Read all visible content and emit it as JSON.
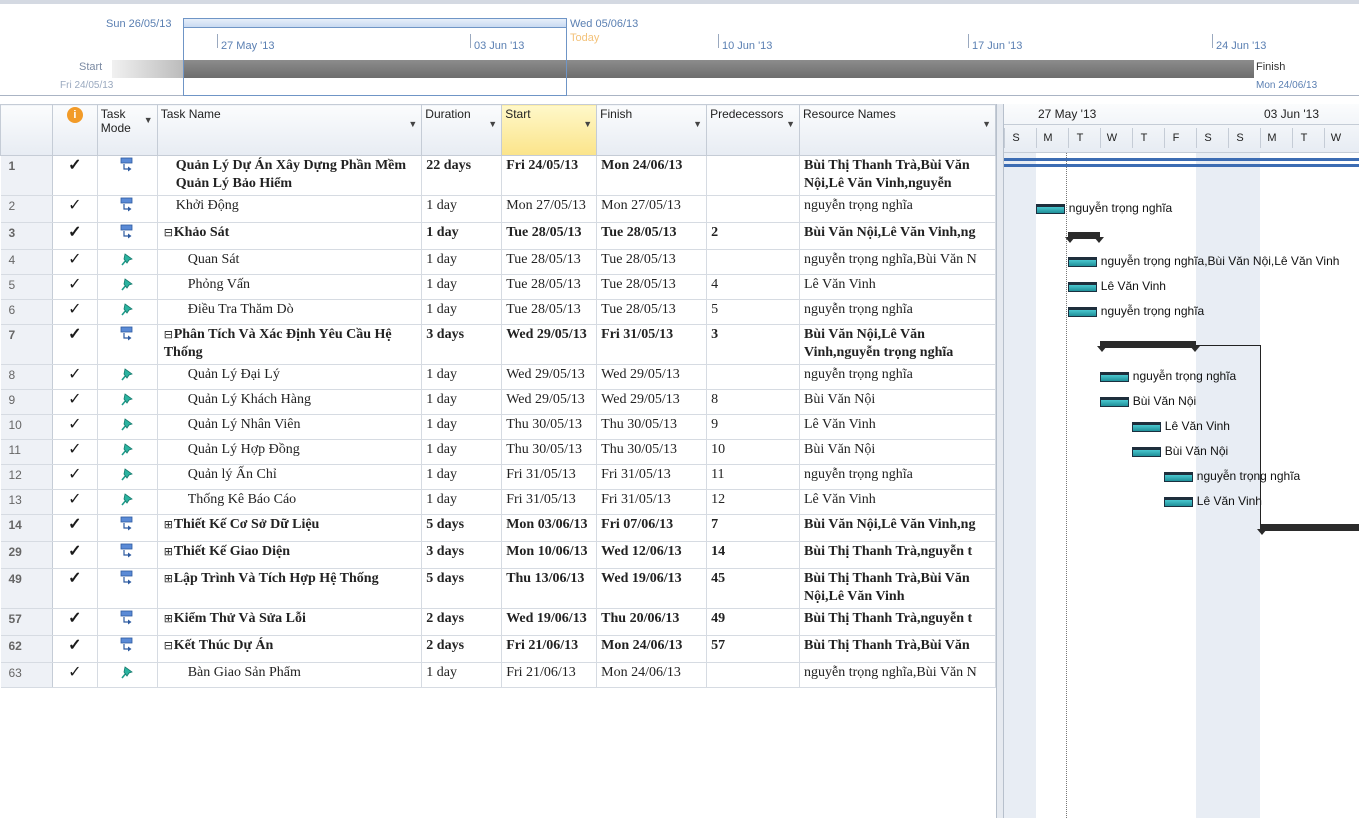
{
  "timeline": {
    "left_date": "Sun 26/05/13",
    "right_date": "Wed 05/06/13",
    "today_label": "Today",
    "start_label": "Start",
    "start_date": "Fri 24/05/13",
    "finish_label": "Finish",
    "finish_date": "Mon 24/06/13",
    "ticks": [
      "27 May '13",
      "03 Jun '13",
      "10 Jun '13",
      "17 Jun '13",
      "24 Jun '13"
    ]
  },
  "columns": {
    "info": "i",
    "task_mode": "Task Mode",
    "task_name": "Task Name",
    "duration": "Duration",
    "start": "Start",
    "finish": "Finish",
    "predecessors": "Predecessors",
    "resource_names": "Resource Names"
  },
  "tasks": [
    {
      "id": "1",
      "mode": "auto",
      "name": "Quản Lý Dự Án Xây Dựng Phần Mềm Quản Lý Bảo Hiểm",
      "duration": "22 days",
      "start": "Fri 24/05/13",
      "finish": "Mon 24/06/13",
      "pred": "",
      "res": "Bùi Thị Thanh Trà,Bùi Văn Nội,Lê Văn Vinh,nguyễn",
      "summary": true,
      "indent": "ind2",
      "wrap": true,
      "toggle": ""
    },
    {
      "id": "2",
      "mode": "auto",
      "name": "Khởi Động",
      "duration": "1 day",
      "start": "Mon 27/05/13",
      "finish": "Mon 27/05/13",
      "pred": "",
      "res": "nguyễn trọng nghĩa",
      "summary": false,
      "indent": "ind2",
      "wrap": false,
      "toggle": ""
    },
    {
      "id": "3",
      "mode": "auto",
      "name": "Khảo Sát",
      "duration": "1 day",
      "start": "Tue 28/05/13",
      "finish": "Tue 28/05/13",
      "pred": "2",
      "res": "Bùi Văn Nội,Lê Văn Vinh,ng",
      "summary": true,
      "indent": "ind1",
      "wrap": false,
      "toggle": "−"
    },
    {
      "id": "4",
      "mode": "manual",
      "name": "Quan Sát",
      "duration": "1 day",
      "start": "Tue 28/05/13",
      "finish": "Tue 28/05/13",
      "pred": "",
      "res": "nguyễn trọng nghĩa,Bùi Văn N",
      "summary": false,
      "indent": "ind3",
      "wrap": false,
      "toggle": ""
    },
    {
      "id": "5",
      "mode": "manual",
      "name": "Phỏng Vấn",
      "duration": "1 day",
      "start": "Tue 28/05/13",
      "finish": "Tue 28/05/13",
      "pred": "4",
      "res": "Lê Văn Vinh",
      "summary": false,
      "indent": "ind3",
      "wrap": false,
      "toggle": ""
    },
    {
      "id": "6",
      "mode": "manual",
      "name": "Điều Tra Thăm Dò",
      "duration": "1 day",
      "start": "Tue 28/05/13",
      "finish": "Tue 28/05/13",
      "pred": "5",
      "res": "nguyễn trọng nghĩa",
      "summary": false,
      "indent": "ind3",
      "wrap": false,
      "toggle": ""
    },
    {
      "id": "7",
      "mode": "auto",
      "name": "Phân Tích Và Xác Định Yêu Cầu Hệ Thống",
      "duration": "3 days",
      "start": "Wed 29/05/13",
      "finish": "Fri 31/05/13",
      "pred": "3",
      "res": "Bùi Văn Nội,Lê Văn Vinh,nguyễn trọng nghĩa",
      "summary": true,
      "indent": "ind1",
      "wrap": true,
      "toggle": "−"
    },
    {
      "id": "8",
      "mode": "manual",
      "name": "Quản Lý Đại Lý",
      "duration": "1 day",
      "start": "Wed 29/05/13",
      "finish": "Wed 29/05/13",
      "pred": "",
      "res": "nguyễn trọng nghĩa",
      "summary": false,
      "indent": "ind3",
      "wrap": false,
      "toggle": ""
    },
    {
      "id": "9",
      "mode": "manual",
      "name": "Quản Lý Khách Hàng",
      "duration": "1 day",
      "start": "Wed 29/05/13",
      "finish": "Wed 29/05/13",
      "pred": "8",
      "res": "Bùi Văn Nội",
      "summary": false,
      "indent": "ind3",
      "wrap": false,
      "toggle": ""
    },
    {
      "id": "10",
      "mode": "manual",
      "name": "Quản Lý Nhân Viên",
      "duration": "1 day",
      "start": "Thu 30/05/13",
      "finish": "Thu 30/05/13",
      "pred": "9",
      "res": "Lê Văn Vinh",
      "summary": false,
      "indent": "ind3",
      "wrap": false,
      "toggle": ""
    },
    {
      "id": "11",
      "mode": "manual",
      "name": "Quản Lý Hợp Đồng",
      "duration": "1 day",
      "start": "Thu 30/05/13",
      "finish": "Thu 30/05/13",
      "pred": "10",
      "res": "Bùi Văn Nội",
      "summary": false,
      "indent": "ind3",
      "wrap": false,
      "toggle": ""
    },
    {
      "id": "12",
      "mode": "manual",
      "name": "Quản lý Ấn Chỉ",
      "duration": "1 day",
      "start": "Fri 31/05/13",
      "finish": "Fri 31/05/13",
      "pred": "11",
      "res": "nguyễn trọng nghĩa",
      "summary": false,
      "indent": "ind3",
      "wrap": false,
      "toggle": ""
    },
    {
      "id": "13",
      "mode": "manual",
      "name": "Thống Kê Báo Cáo",
      "duration": "1 day",
      "start": "Fri 31/05/13",
      "finish": "Fri 31/05/13",
      "pred": "12",
      "res": "Lê Văn Vinh",
      "summary": false,
      "indent": "ind3",
      "wrap": false,
      "toggle": ""
    },
    {
      "id": "14",
      "mode": "auto",
      "name": "Thiết Kế Cơ Sở Dữ Liệu",
      "duration": "5 days",
      "start": "Mon 03/06/13",
      "finish": "Fri 07/06/13",
      "pred": "7",
      "res": "Bùi Văn Nội,Lê Văn Vinh,ng",
      "summary": true,
      "indent": "ind1",
      "wrap": false,
      "toggle": "+"
    },
    {
      "id": "29",
      "mode": "auto",
      "name": "Thiết Kế Giao Diện",
      "duration": "3 days",
      "start": "Mon 10/06/13",
      "finish": "Wed 12/06/13",
      "pred": "14",
      "res": "Bùi Thị Thanh Trà,nguyễn t",
      "summary": true,
      "indent": "ind1",
      "wrap": false,
      "toggle": "+"
    },
    {
      "id": "49",
      "mode": "auto",
      "name": "Lập Trình Và Tích Hợp Hệ Thống",
      "duration": "5 days",
      "start": "Thu 13/06/13",
      "finish": "Wed 19/06/13",
      "pred": "45",
      "res": "Bùi Thị Thanh Trà,Bùi Văn Nội,Lê Văn Vinh",
      "summary": true,
      "indent": "ind1",
      "wrap": true,
      "toggle": "+"
    },
    {
      "id": "57",
      "mode": "auto",
      "name": "Kiểm Thử Và Sửa Lỗi",
      "duration": "2 days",
      "start": "Wed 19/06/13",
      "finish": "Thu 20/06/13",
      "pred": "49",
      "res": "Bùi Thị Thanh Trà,nguyễn t",
      "summary": true,
      "indent": "ind1",
      "wrap": false,
      "toggle": "+"
    },
    {
      "id": "62",
      "mode": "auto",
      "name": "Kết Thúc Dự Án",
      "duration": "2 days",
      "start": "Fri 21/06/13",
      "finish": "Mon 24/06/13",
      "pred": "57",
      "res": "Bùi Thị Thanh Trà,Bùi Văn",
      "summary": true,
      "indent": "ind1",
      "wrap": false,
      "toggle": "−"
    },
    {
      "id": "63",
      "mode": "manual",
      "name": "Bàn Giao Sản Phẩm",
      "duration": "1 day",
      "start": "Fri 21/06/13",
      "finish": "Mon 24/06/13",
      "pred": "",
      "res": "nguyễn trọng nghĩa,Bùi Văn N",
      "summary": false,
      "indent": "ind3",
      "wrap": false,
      "toggle": ""
    }
  ],
  "gantt": {
    "weeks": [
      "27 May '13",
      "03 Jun '13"
    ],
    "days": [
      "S",
      "M",
      "T",
      "W",
      "T",
      "F",
      "S",
      "S",
      "M",
      "T",
      "W"
    ],
    "labels": [
      {
        "row": "2",
        "text": "nguyễn trọng nghĩa"
      },
      {
        "row": "4",
        "text": "nguyễn trọng nghĩa,Bùi Văn Nội,Lê Văn Vinh"
      },
      {
        "row": "5",
        "text": "Lê Văn Vinh"
      },
      {
        "row": "6",
        "text": "nguyễn trọng nghĩa"
      },
      {
        "row": "8",
        "text": "nguyễn trọng nghĩa"
      },
      {
        "row": "9",
        "text": "Bùi Văn Nội"
      },
      {
        "row": "10",
        "text": "Lê Văn Vinh"
      },
      {
        "row": "11",
        "text": "Bùi Văn Nội"
      },
      {
        "row": "12",
        "text": "nguyễn trọng nghĩa"
      },
      {
        "row": "13",
        "text": "Lê Văn Vinh"
      }
    ]
  }
}
